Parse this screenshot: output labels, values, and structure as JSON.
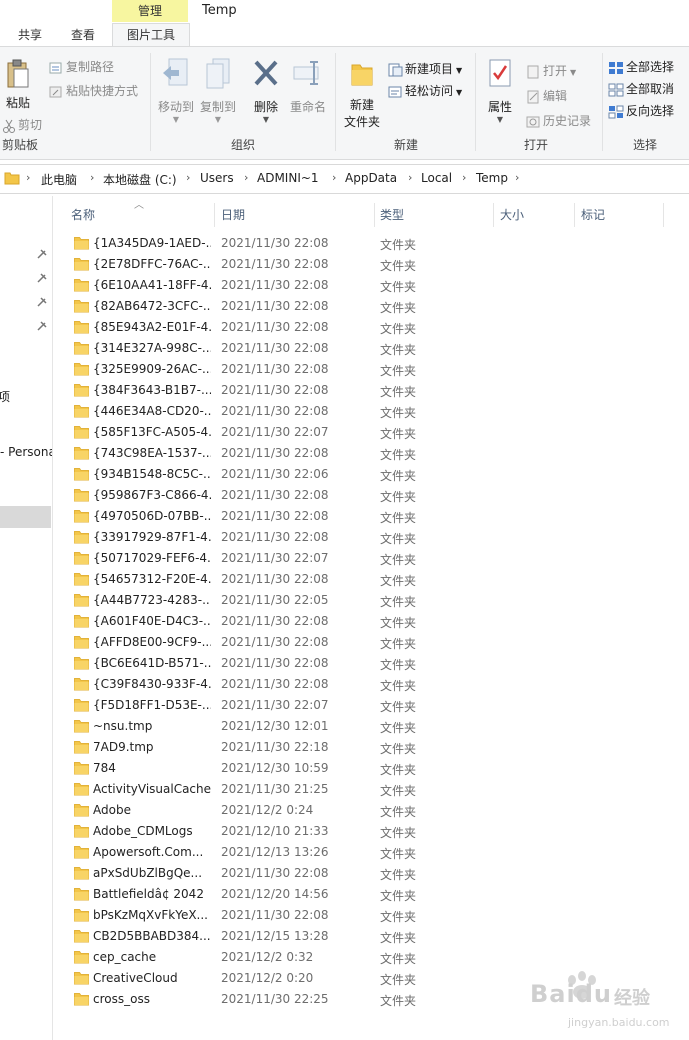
{
  "ribbon_tabs": {
    "context_header": "管理",
    "window_title": "Temp",
    "share": "共享",
    "view": "查看",
    "picture_tools": "图片工具"
  },
  "ribbon": {
    "clipboard": {
      "paste": "粘贴",
      "copy_path": "复制路径",
      "paste_shortcut": "粘贴快捷方式",
      "cut": "剪切",
      "label": "剪贴板"
    },
    "organize": {
      "move_to": "移动到",
      "copy_to": "复制到",
      "delete": "删除",
      "rename": "重命名",
      "label": "组织"
    },
    "new": {
      "new_folder_line1": "新建",
      "new_folder_line2": "文件夹",
      "new_item": "新建项目",
      "easy_access": "轻松访问",
      "label": "新建"
    },
    "open": {
      "properties": "属性",
      "open": "打开",
      "edit": "编辑",
      "history": "历史记录",
      "label": "打开"
    },
    "select": {
      "select_all": "全部选择",
      "select_none": "全部取消",
      "invert": "反向选择",
      "label": "选择"
    }
  },
  "address_bar": {
    "crumbs": [
      "此电脑",
      "本地磁盘 (C:)",
      "Users",
      "ADMINI~1",
      "AppData",
      "Local",
      "Temp"
    ]
  },
  "nav_pane": {
    "item_a": "项",
    "item_b": "- Persona"
  },
  "columns": {
    "name": "名称",
    "date": "日期",
    "type": "类型",
    "size": "大小",
    "tags": "标记"
  },
  "files": [
    {
      "name": "{1A345DA9-1AED-...",
      "date": "2021/11/30 22:08",
      "type": "文件夹"
    },
    {
      "name": "{2E78DFFC-76AC-...",
      "date": "2021/11/30 22:08",
      "type": "文件夹"
    },
    {
      "name": "{6E10AA41-18FF-4...",
      "date": "2021/11/30 22:08",
      "type": "文件夹"
    },
    {
      "name": "{82AB6472-3CFC-...",
      "date": "2021/11/30 22:08",
      "type": "文件夹"
    },
    {
      "name": "{85E943A2-E01F-4...",
      "date": "2021/11/30 22:08",
      "type": "文件夹"
    },
    {
      "name": "{314E327A-998C-...",
      "date": "2021/11/30 22:08",
      "type": "文件夹"
    },
    {
      "name": "{325E9909-26AC-...",
      "date": "2021/11/30 22:08",
      "type": "文件夹"
    },
    {
      "name": "{384F3643-B1B7-...",
      "date": "2021/11/30 22:08",
      "type": "文件夹"
    },
    {
      "name": "{446E34A8-CD20-...",
      "date": "2021/11/30 22:08",
      "type": "文件夹"
    },
    {
      "name": "{585F13FC-A505-4...",
      "date": "2021/11/30 22:07",
      "type": "文件夹"
    },
    {
      "name": "{743C98EA-1537-...",
      "date": "2021/11/30 22:08",
      "type": "文件夹"
    },
    {
      "name": "{934B1548-8C5C-...",
      "date": "2021/11/30 22:06",
      "type": "文件夹"
    },
    {
      "name": "{959867F3-C866-4...",
      "date": "2021/11/30 22:08",
      "type": "文件夹"
    },
    {
      "name": "{4970506D-07BB-...",
      "date": "2021/11/30 22:08",
      "type": "文件夹"
    },
    {
      "name": "{33917929-87F1-4...",
      "date": "2021/11/30 22:08",
      "type": "文件夹"
    },
    {
      "name": "{50717029-FEF6-4...",
      "date": "2021/11/30 22:07",
      "type": "文件夹"
    },
    {
      "name": "{54657312-F20E-4...",
      "date": "2021/11/30 22:08",
      "type": "文件夹"
    },
    {
      "name": "{A44B7723-4283-...",
      "date": "2021/11/30 22:05",
      "type": "文件夹"
    },
    {
      "name": "{A601F40E-D4C3-...",
      "date": "2021/11/30 22:08",
      "type": "文件夹"
    },
    {
      "name": "{AFFD8E00-9CF9-...",
      "date": "2021/11/30 22:08",
      "type": "文件夹"
    },
    {
      "name": "{BC6E641D-B571-...",
      "date": "2021/11/30 22:08",
      "type": "文件夹"
    },
    {
      "name": "{C39F8430-933F-4...",
      "date": "2021/11/30 22:08",
      "type": "文件夹"
    },
    {
      "name": "{F5D18FF1-D53E-...",
      "date": "2021/11/30 22:07",
      "type": "文件夹"
    },
    {
      "name": "~nsu.tmp",
      "date": "2021/12/30 12:01",
      "type": "文件夹"
    },
    {
      "name": "7AD9.tmp",
      "date": "2021/11/30 22:18",
      "type": "文件夹"
    },
    {
      "name": "784",
      "date": "2021/12/30 10:59",
      "type": "文件夹"
    },
    {
      "name": "ActivityVisualCache",
      "date": "2021/11/30 21:25",
      "type": "文件夹"
    },
    {
      "name": "Adobe",
      "date": "2021/12/2 0:24",
      "type": "文件夹"
    },
    {
      "name": "Adobe_CDMLogs",
      "date": "2021/12/10 21:33",
      "type": "文件夹"
    },
    {
      "name": "Apowersoft.Com...",
      "date": "2021/12/13 13:26",
      "type": "文件夹"
    },
    {
      "name": "aPxSdUbZlBgQe...",
      "date": "2021/11/30 22:08",
      "type": "文件夹"
    },
    {
      "name": "Battlefieldâ¢ 2042",
      "date": "2021/12/20 14:56",
      "type": "文件夹"
    },
    {
      "name": "bPsKzMqXvFkYeX...",
      "date": "2021/11/30 22:08",
      "type": "文件夹"
    },
    {
      "name": "CB2D5BBABD384...",
      "date": "2021/12/15 13:28",
      "type": "文件夹"
    },
    {
      "name": "cep_cache",
      "date": "2021/12/2 0:32",
      "type": "文件夹"
    },
    {
      "name": "CreativeCloud",
      "date": "2021/12/2 0:20",
      "type": "文件夹"
    },
    {
      "name": "cross_oss",
      "date": "2021/11/30 22:25",
      "type": "文件夹"
    }
  ],
  "watermark": {
    "brand": "Baidu",
    "brand_cn": "经验",
    "url": "jingyan.baidu.com"
  }
}
